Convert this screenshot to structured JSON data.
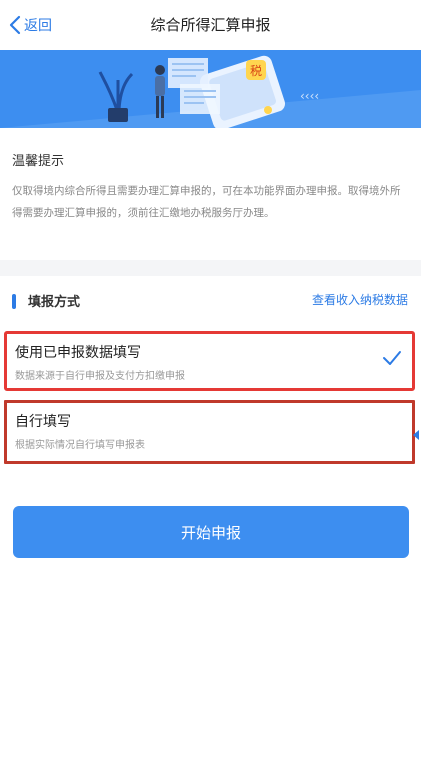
{
  "navbar": {
    "back_label": "返回",
    "title": "综合所得汇算申报"
  },
  "notice": {
    "title": "温馨提示",
    "text": "仅取得境内综合所得且需要办理汇算申报的，可在本功能界面办理申报。取得境外所得需要办理汇算申报的，须前往汇缴地办税服务厅办理。"
  },
  "section": {
    "title": "填报方式",
    "link": "查看收入纳税数据"
  },
  "options": [
    {
      "label": "使用已申报数据填写",
      "desc": "数据来源于自行申报及支付方扣缴申报",
      "selected": true
    },
    {
      "label": "自行填写",
      "desc": "根据实际情况自行填写申报表",
      "selected": false
    }
  ],
  "start_button": "开始申报",
  "banner": {
    "badge_char": "税"
  },
  "colors": {
    "accent": "#2c7be5",
    "banner": "#3d8ef0",
    "highlight": "#e53935"
  }
}
